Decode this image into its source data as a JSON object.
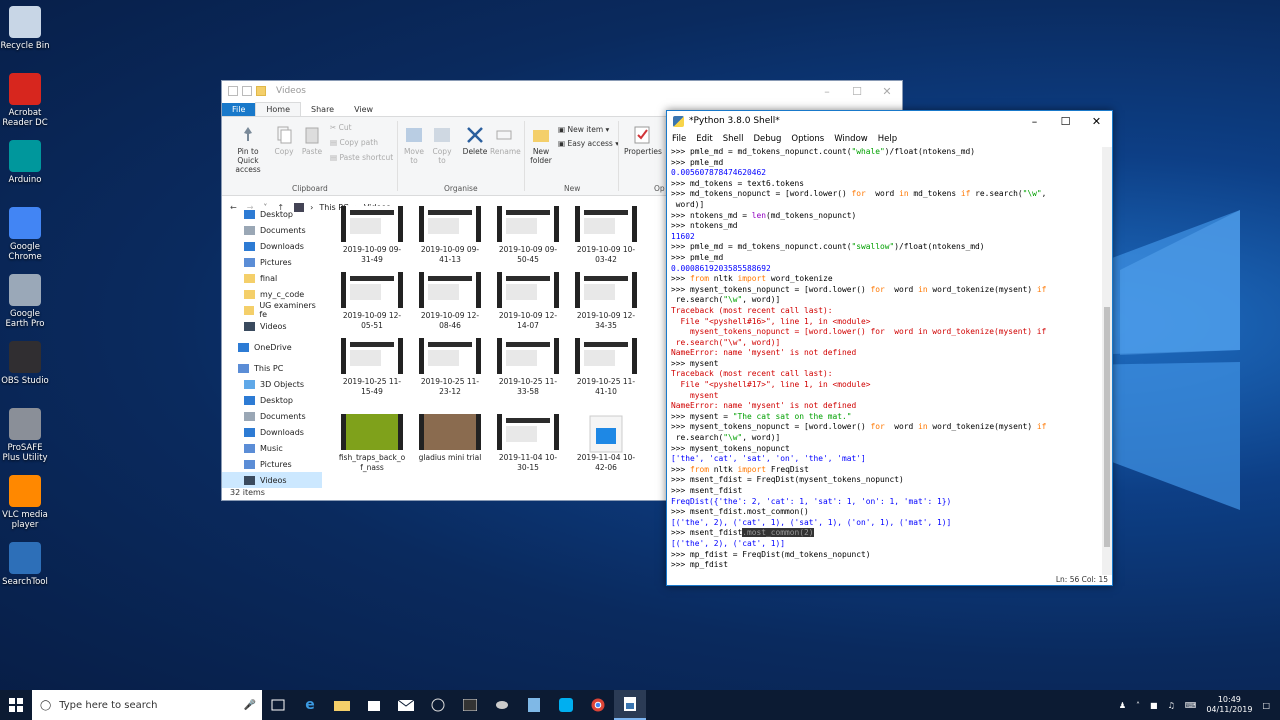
{
  "desktop_icons": [
    {
      "label": "Recycle Bin",
      "icon": "recycle-bin-icon",
      "color": "#c8d6e6"
    },
    {
      "label": "Acrobat Reader DC",
      "icon": "acrobat-icon",
      "color": "#d7261e"
    },
    {
      "label": "Arduino",
      "icon": "arduino-icon",
      "color": "#00979c"
    },
    {
      "label": "Google Chrome",
      "icon": "chrome-icon",
      "color": "#4285f4"
    },
    {
      "label": "Google Earth Pro",
      "icon": "google-earth-icon",
      "color": "#9aa8b8"
    },
    {
      "label": "OBS Studio",
      "icon": "obs-icon",
      "color": "#302e31"
    },
    {
      "label": "ProSAFE Plus Utility",
      "icon": "prosafe-icon",
      "color": "#8a8f98"
    },
    {
      "label": "VLC media player",
      "icon": "vlc-icon",
      "color": "#ff8800"
    },
    {
      "label": "SearchTool",
      "icon": "searchtool-icon",
      "color": "#2d6fb8"
    }
  ],
  "explorer": {
    "title": "Videos",
    "tabs": {
      "file": "File",
      "home": "Home",
      "share": "Share",
      "view": "View"
    },
    "ribbon": {
      "pin": "Pin to Quick access",
      "copy": "Copy",
      "paste": "Paste",
      "cut": "Cut",
      "copy_path": "Copy path",
      "paste_shortcut": "Paste shortcut",
      "move_to": "Move to",
      "copy_to": "Copy to",
      "delete": "Delete",
      "rename": "Rename",
      "new_folder": "New folder",
      "new_item": "New item",
      "easy_access": "Easy access",
      "properties": "Properties",
      "groups": {
        "clipboard": "Clipboard",
        "organise": "Organise",
        "new": "New",
        "open": "Op"
      }
    },
    "address": {
      "root": "This PC",
      "current": "Videos"
    },
    "nav": {
      "quick": [
        "Desktop",
        "Documents",
        "Downloads",
        "Pictures",
        "final",
        "my_c_code",
        "UG examiners fe",
        "Videos"
      ],
      "onedrive": "OneDrive",
      "thispc": "This PC",
      "pc_items": [
        "3D Objects",
        "Desktop",
        "Documents",
        "Downloads",
        "Music",
        "Pictures",
        "Videos"
      ]
    },
    "files": [
      {
        "name": "2019-10-09 09-31-49"
      },
      {
        "name": "2019-10-09 09-41-13"
      },
      {
        "name": "2019-10-09 09-50-45"
      },
      {
        "name": "2019-10-09 10-03-42"
      },
      {
        "name": "2019-10-09 12-05-51"
      },
      {
        "name": "2019-10-09 12-08-46"
      },
      {
        "name": "2019-10-09 12-14-07"
      },
      {
        "name": "2019-10-09 12-34-35"
      },
      {
        "name": "2019-10-25 11-15-49"
      },
      {
        "name": "2019-10-25 11-23-12"
      },
      {
        "name": "2019-10-25 11-33-58"
      },
      {
        "name": "2019-10-25 11-41-10"
      },
      {
        "name": "fish_traps_back_o f_nass"
      },
      {
        "name": "gladius mini trial"
      },
      {
        "name": "2019-11-04 10-30-15"
      },
      {
        "name": "2019-11-04 10-42-06"
      }
    ],
    "status": "32 items"
  },
  "shell": {
    "title": "*Python 3.8.0 Shell*",
    "menu": [
      "File",
      "Edit",
      "Shell",
      "Debug",
      "Options",
      "Window",
      "Help"
    ],
    "status": "Ln: 56   Col: 15"
  },
  "taskbar": {
    "search_placeholder": "Type here to search",
    "time": "10:49",
    "date": "04/11/2019"
  }
}
